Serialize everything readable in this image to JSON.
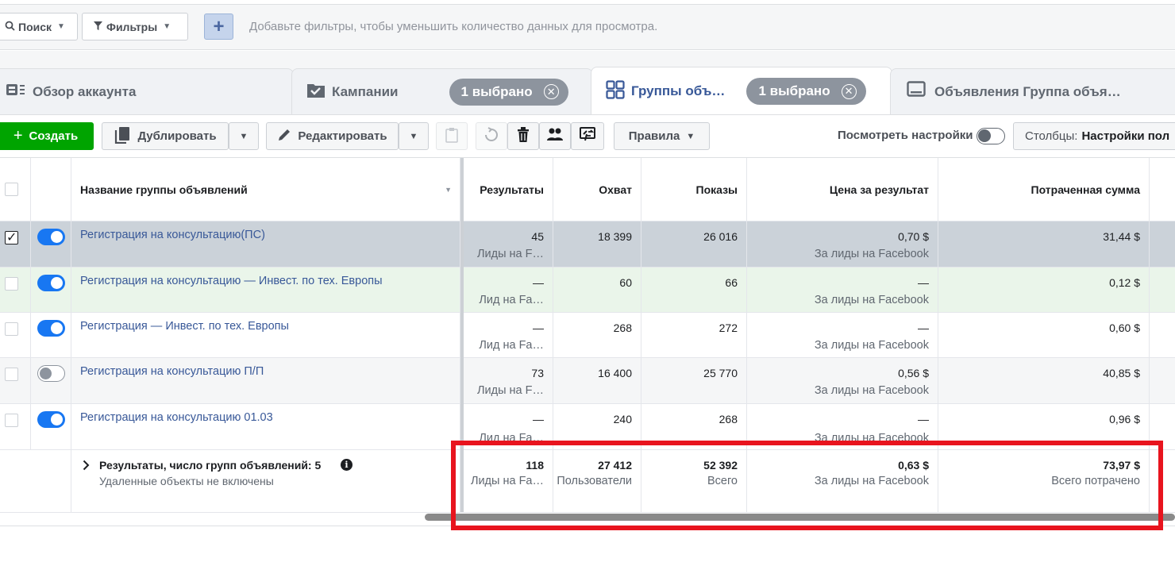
{
  "filterbar": {
    "search_label": "Поиск",
    "filters_label": "Фильтры",
    "add_label": "+",
    "hint": "Добавьте фильтры, чтобы уменьшить количество данных для просмотра."
  },
  "tabs": [
    {
      "label": "Обзор аккаунта",
      "icon": "account-overview-icon"
    },
    {
      "label": "Кампании",
      "icon": "folder-icon",
      "pill": "1 выбрано"
    },
    {
      "label": "Группы объ…",
      "icon": "grid-icon",
      "pill": "1 выбрано",
      "active": true
    },
    {
      "label": "Объявления Группа объя…",
      "icon": "monitor-icon"
    }
  ],
  "toolbar": {
    "create": "Создать",
    "duplicate": "Дублировать",
    "edit": "Редактировать",
    "rules": "Правила",
    "view_settings": "Посмотреть настройки",
    "columns_prefix": "Столбцы:",
    "columns_value": "Настройки пол"
  },
  "table": {
    "headers": {
      "name": "Название группы объявлений",
      "results": "Результаты",
      "reach": "Охват",
      "impressions": "Показы",
      "cost": "Цена за результат",
      "spent": "Потраченная сумма"
    },
    "rows": [
      {
        "name": "Регистрация на консультацию(ПС)",
        "results": "45",
        "results_sub": "Лиды на F…",
        "reach": "18 399",
        "impressions": "26 016",
        "cost": "0,70 $",
        "cost_sub": "За лиды на Facebook",
        "spent": "31,44 $"
      },
      {
        "name": "Регистрация на консультацию — Инвест. по тех. Европы",
        "results": "—",
        "results_sub": "Лид на Fa…",
        "reach": "60",
        "impressions": "66",
        "cost": "—",
        "cost_sub": "За лиды на Facebook",
        "spent": "0,12 $"
      },
      {
        "name": "Регистрация — Инвест. по тех. Европы",
        "results": "—",
        "results_sub": "Лид на Fa…",
        "reach": "268",
        "impressions": "272",
        "cost": "—",
        "cost_sub": "За лиды на Facebook",
        "spent": "0,60 $"
      },
      {
        "name": "Регистрация на консультацию П/П",
        "results": "73",
        "results_sub": "Лиды на F…",
        "reach": "16 400",
        "impressions": "25 770",
        "cost": "0,56 $",
        "cost_sub": "За лиды на Facebook",
        "spent": "40,85 $"
      },
      {
        "name": "Регистрация на консультацию 01.03",
        "results": "—",
        "results_sub": "Лид на Fa…",
        "reach": "240",
        "impressions": "268",
        "cost": "—",
        "cost_sub": "За лиды на Facebook",
        "spent": "0,96 $"
      }
    ],
    "totals": {
      "title": "Результаты, число групп объявлений: 5",
      "note": "Удаленные объекты не включены",
      "results": "118",
      "results_sub": "Лиды на Fa…",
      "reach": "27 412",
      "reach_sub": "Пользователи",
      "impressions": "52 392",
      "impressions_sub": "Всего",
      "cost": "0,63 $",
      "cost_sub": "За лиды на Facebook",
      "spent": "73,97 $",
      "spent_sub": "Всего потрачено"
    }
  },
  "colors": {
    "link": "#385898",
    "create": "#00a400",
    "toggle_on": "#1877f2",
    "highlight": "#e8141e"
  }
}
